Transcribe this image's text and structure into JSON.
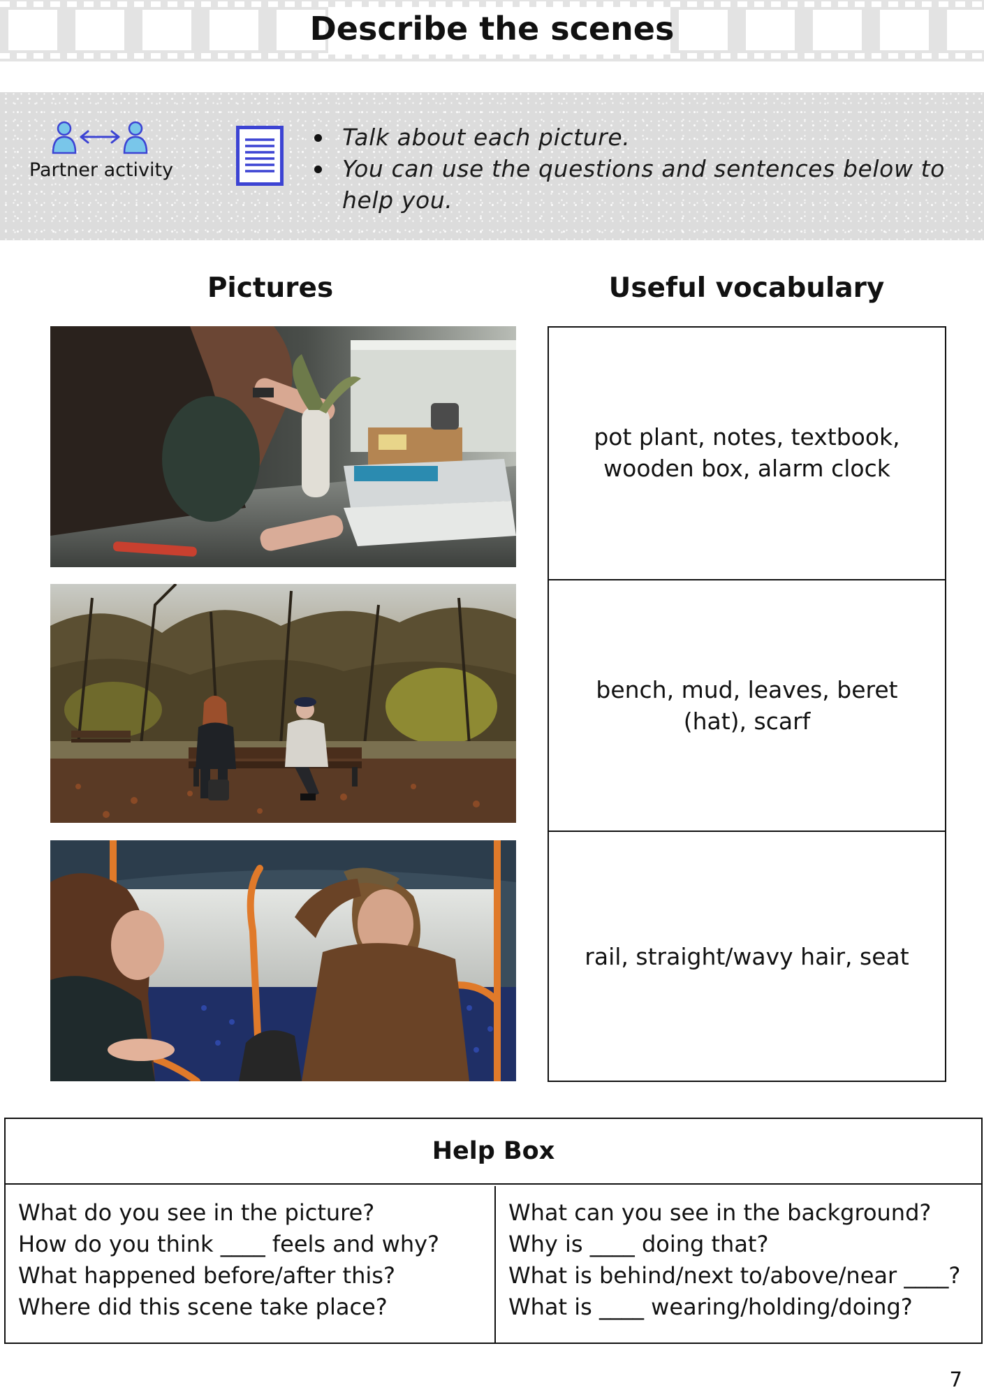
{
  "header": {
    "title": "Describe the scenes"
  },
  "banner": {
    "partner_icon": "partner-activity-icon",
    "partner_label": "Partner activity",
    "document_icon": "document-icon",
    "accent_color": "#3c43d3",
    "partner_color": "#79c6ea",
    "instructions": [
      "Talk about each picture.",
      "You can use the questions and sentences below to help you."
    ]
  },
  "columns": {
    "pictures": "Pictures",
    "vocabulary": "Useful vocabulary"
  },
  "scenes": [
    {
      "picture": "girl-studying-at-desk-photo",
      "vocabulary": "pot plant, notes, textbook, wooden box, alarm clock"
    },
    {
      "picture": "park-bench-autumn-photo",
      "vocabulary": "bench, mud, leaves, beret (hat), scarf"
    },
    {
      "picture": "bus-passengers-photo",
      "vocabulary": "rail, straight/wavy hair, seat"
    }
  ],
  "help_box": {
    "title": "Help Box",
    "left": [
      "What do you see in the picture?",
      "How do you think ____ feels and why?",
      "What happened before/after this?",
      "Where did this scene take place?"
    ],
    "right": [
      "What can you see in the background?",
      "Why is ____ doing that?",
      "What is behind/next to/above/near ____?",
      "What is ____ wearing/holding/doing?"
    ]
  },
  "page_number": "7"
}
